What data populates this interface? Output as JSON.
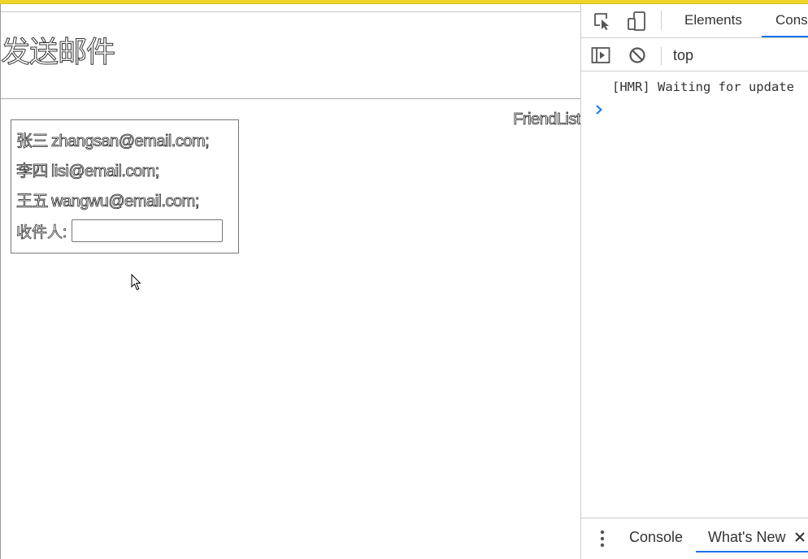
{
  "page": {
    "title": "发送邮件",
    "friendlist_label": "FriendList",
    "friends": [
      {
        "name": "张三",
        "email": "zhangsan@email.com;"
      },
      {
        "name": "李四",
        "email": "lisi@email.com;"
      },
      {
        "name": "王五",
        "email": "wangwu@email.com;"
      }
    ],
    "recipient_label": "收件人:",
    "recipient_value": ""
  },
  "devtools": {
    "tabs": [
      "Elements",
      "Cons"
    ],
    "active_tab": "Cons",
    "context": "top",
    "console_lines": [
      "[HMR] Waiting for update"
    ],
    "drawer_tabs": [
      "Console",
      "What's New"
    ],
    "active_drawer_tab": "What's New",
    "accent_color": "#1a73e8"
  },
  "colors": {
    "top_bar": "#f1d428",
    "prompt": "#1a73e8"
  },
  "icons": [
    "inspect-element-icon",
    "device-toolbar-icon",
    "sidebar-toggle-icon",
    "clear-console-icon",
    "prompt-chevron-icon",
    "kebab-menu-icon",
    "close-icon",
    "mouse-cursor-icon"
  ]
}
